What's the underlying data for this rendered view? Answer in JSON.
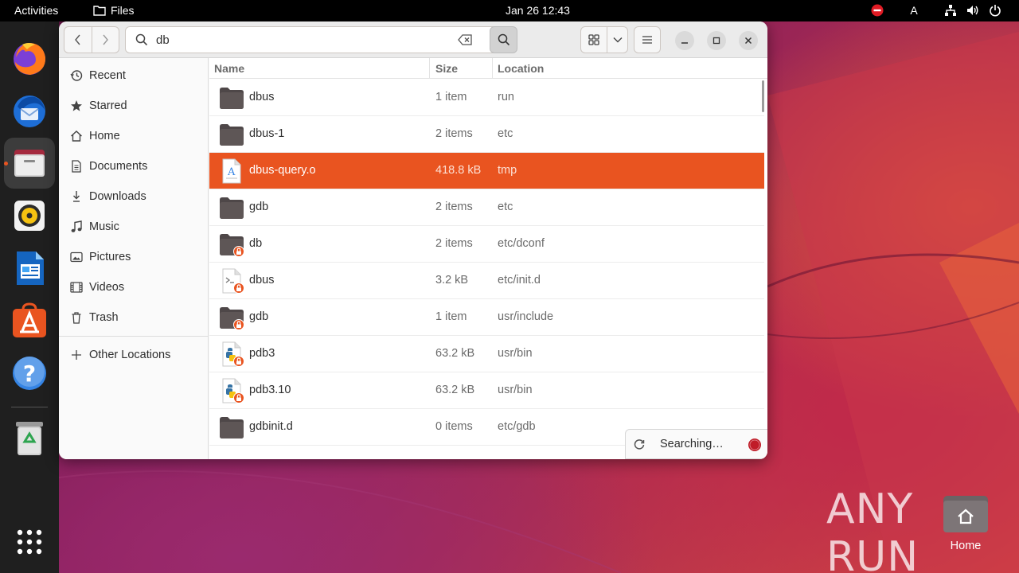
{
  "topbar": {
    "activities": "Activities",
    "app_name": "Files",
    "clock": "Jan 26  12:43",
    "input_method": "A"
  },
  "dock": {
    "items": [
      "firefox-icon",
      "thunderbird-icon",
      "files-icon",
      "rhythmbox-icon",
      "libreoffice-writer-icon",
      "app-center-icon",
      "help-icon",
      "trash-icon",
      "show-apps-icon"
    ]
  },
  "window": {
    "search_query": "db",
    "sidebar": {
      "items": [
        {
          "label": "Recent",
          "icon": "clock-icon"
        },
        {
          "label": "Starred",
          "icon": "star-icon"
        },
        {
          "label": "Home",
          "icon": "home-icon"
        },
        {
          "label": "Documents",
          "icon": "document-icon"
        },
        {
          "label": "Downloads",
          "icon": "download-icon"
        },
        {
          "label": "Music",
          "icon": "music-icon"
        },
        {
          "label": "Pictures",
          "icon": "picture-icon"
        },
        {
          "label": "Videos",
          "icon": "video-icon"
        },
        {
          "label": "Trash",
          "icon": "trash-icon"
        }
      ],
      "other_locations": "Other Locations"
    },
    "columns": {
      "name": "Name",
      "size": "Size",
      "location": "Location"
    },
    "rows": [
      {
        "name": "dbus",
        "size": "1 item",
        "location": "run",
        "type": "folder",
        "locked": false
      },
      {
        "name": "dbus-1",
        "size": "2 items",
        "location": "etc",
        "type": "folder",
        "locked": false
      },
      {
        "name": "dbus-query.o",
        "size": "418.8 kB",
        "location": "tmp",
        "type": "text",
        "locked": false,
        "selected": true
      },
      {
        "name": "gdb",
        "size": "2 items",
        "location": "etc",
        "type": "folder",
        "locked": false
      },
      {
        "name": "db",
        "size": "2 items",
        "location": "etc/dconf",
        "type": "folder",
        "locked": true
      },
      {
        "name": "dbus",
        "size": "3.2 kB",
        "location": "etc/init.d",
        "type": "script",
        "locked": true
      },
      {
        "name": "gdb",
        "size": "1 item",
        "location": "usr/include",
        "type": "folder",
        "locked": true
      },
      {
        "name": "pdb3",
        "size": "63.2 kB",
        "location": "usr/bin",
        "type": "python",
        "locked": true
      },
      {
        "name": "pdb3.10",
        "size": "63.2 kB",
        "location": "usr/bin",
        "type": "python",
        "locked": true
      },
      {
        "name": "gdbinit.d",
        "size": "0 items",
        "location": "etc/gdb",
        "type": "folder",
        "locked": false
      }
    ],
    "status": "Searching…"
  },
  "desktop": {
    "home_label": "Home",
    "watermark": "ANY RUN"
  },
  "colors": {
    "accent": "#e95420",
    "topbar": "#000000",
    "dock": "#1f1f1f",
    "folder": "#5e5656"
  }
}
